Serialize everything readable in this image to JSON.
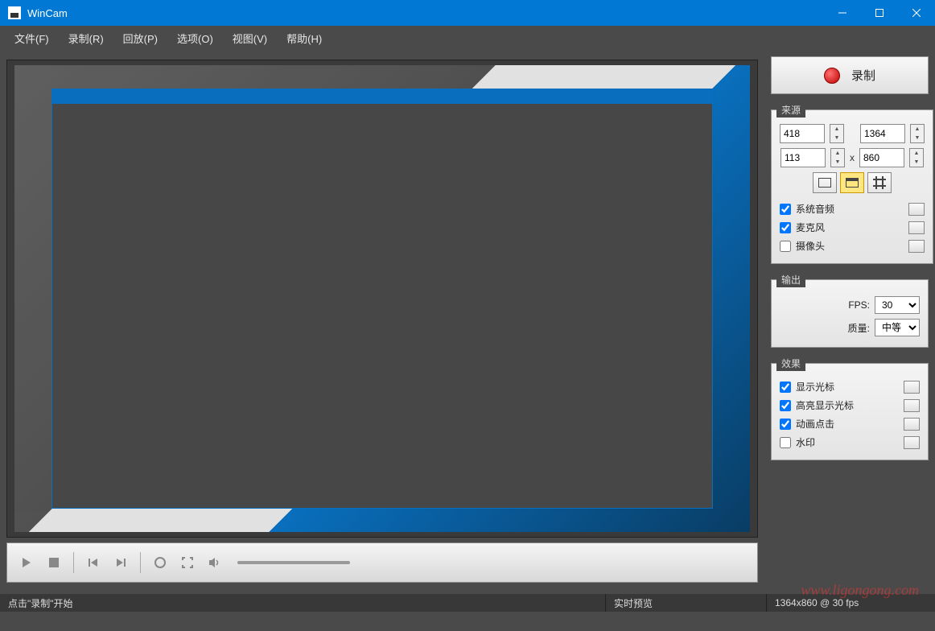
{
  "window": {
    "title": "WinCam"
  },
  "menu": {
    "file": "文件(F)",
    "record": "录制(R)",
    "playback": "回放(P)",
    "options": "选项(O)",
    "view": "视图(V)",
    "help": "帮助(H)"
  },
  "record_button": {
    "label": "录制"
  },
  "source": {
    "legend": "来源",
    "x": "418",
    "y": "113",
    "w": "1364",
    "h": "860",
    "sep": "x",
    "checks": {
      "system_audio": "系统音频",
      "microphone": "麦克风",
      "camera": "摄像头"
    }
  },
  "output": {
    "legend": "输出",
    "fps_label": "FPS:",
    "fps_value": "30",
    "quality_label": "质量:",
    "quality_value": "中等"
  },
  "effects": {
    "legend": "效果",
    "show_cursor": "显示光标",
    "highlight_cursor": "高亮显示光标",
    "animate_clicks": "动画点击",
    "watermark": "水印"
  },
  "status": {
    "hint": "点击\"录制\"开始",
    "preview": "实时预览",
    "resolution": "1364x860 @ 30 fps"
  },
  "watermark_text": "www.ligongong.com"
}
